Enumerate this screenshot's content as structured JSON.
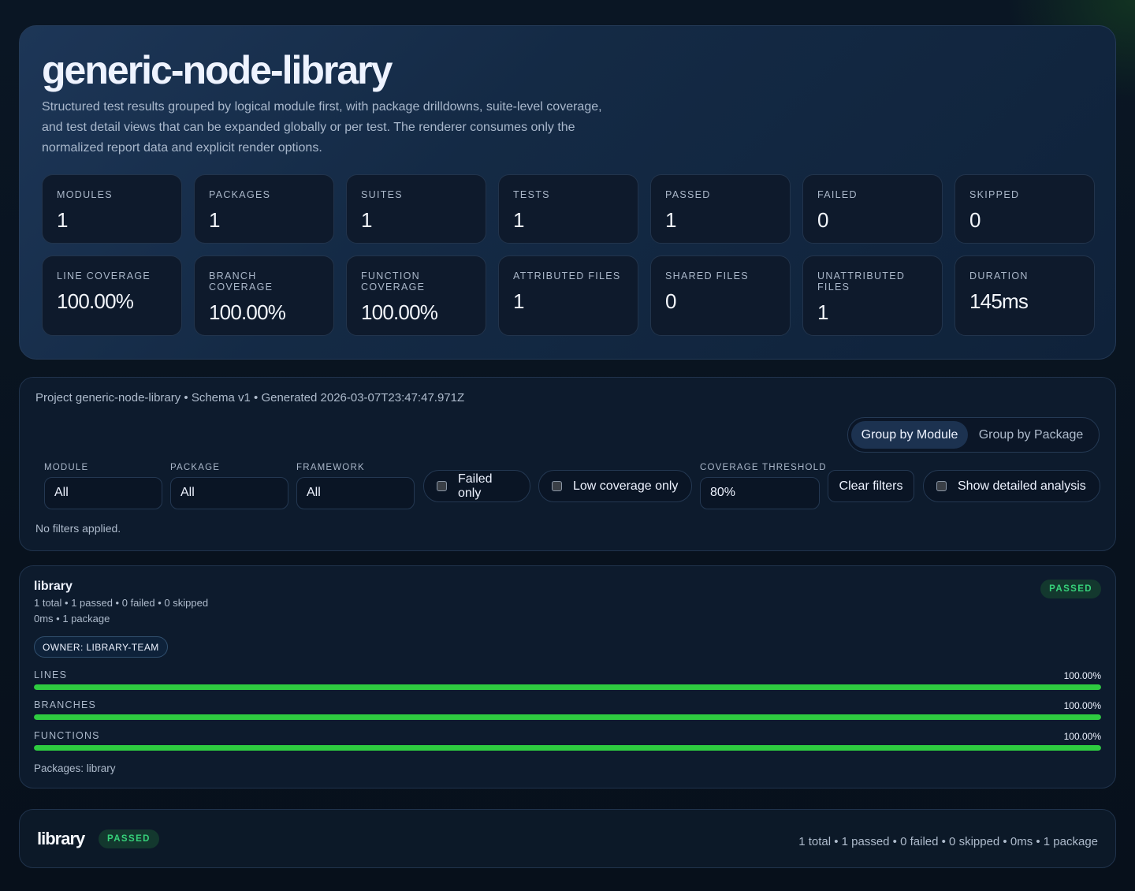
{
  "hero": {
    "title": "generic-node-library",
    "description": "Structured test results grouped by logical module first, with package drilldowns, suite-level coverage, and test detail views that can be expanded globally or per test. The renderer consumes only the normalized report data and explicit render options."
  },
  "stats_row1": [
    {
      "label": "MODULES",
      "value": "1"
    },
    {
      "label": "PACKAGES",
      "value": "1"
    },
    {
      "label": "SUITES",
      "value": "1"
    },
    {
      "label": "TESTS",
      "value": "1"
    },
    {
      "label": "PASSED",
      "value": "1"
    },
    {
      "label": "FAILED",
      "value": "0"
    },
    {
      "label": "SKIPPED",
      "value": "0"
    }
  ],
  "stats_row2": [
    {
      "label": "LINE COVERAGE",
      "value": "100.00%"
    },
    {
      "label": "BRANCH COVERAGE",
      "value": "100.00%"
    },
    {
      "label": "FUNCTION COVERAGE",
      "value": "100.00%"
    },
    {
      "label": "ATTRIBUTED FILES",
      "value": "1"
    },
    {
      "label": "SHARED FILES",
      "value": "0"
    },
    {
      "label": "UNATTRIBUTED FILES",
      "value": "1"
    },
    {
      "label": "DURATION",
      "value": "145ms"
    }
  ],
  "filters": {
    "meta": "Project generic-node-library • Schema v1 • Generated 2026-03-07T23:47:47.971Z",
    "group_by_module": "Group by Module",
    "group_by_package": "Group by Package",
    "module_label": "MODULE",
    "module_value": "All",
    "package_label": "PACKAGE",
    "package_value": "All",
    "framework_label": "FRAMEWORK",
    "framework_value": "All",
    "failed_only": "Failed only",
    "low_coverage_only": "Low coverage only",
    "threshold_label": "COVERAGE THRESHOLD",
    "threshold_value": "80%",
    "clear_filters": "Clear filters",
    "show_detailed": "Show detailed analysis",
    "status": "No filters applied."
  },
  "module": {
    "name": "library",
    "counts": "1 total • 1 passed • 0 failed • 0 skipped",
    "meta": "0ms • 1 package",
    "status": "PASSED",
    "owner": "OWNER: LIBRARY-TEAM",
    "coverage": [
      {
        "label": "LINES",
        "pct_text": "100.00%",
        "pct": 100
      },
      {
        "label": "BRANCHES",
        "pct_text": "100.00%",
        "pct": 100
      },
      {
        "label": "FUNCTIONS",
        "pct_text": "100.00%",
        "pct": 100
      }
    ],
    "packages": "Packages: library",
    "colors": {
      "fill": "#2ecc40",
      "badge_text": "#36d27a"
    }
  },
  "package": {
    "name": "library",
    "status": "PASSED",
    "summary": "1 total • 1 passed • 0 failed • 0 skipped • 0ms • 1 package"
  }
}
